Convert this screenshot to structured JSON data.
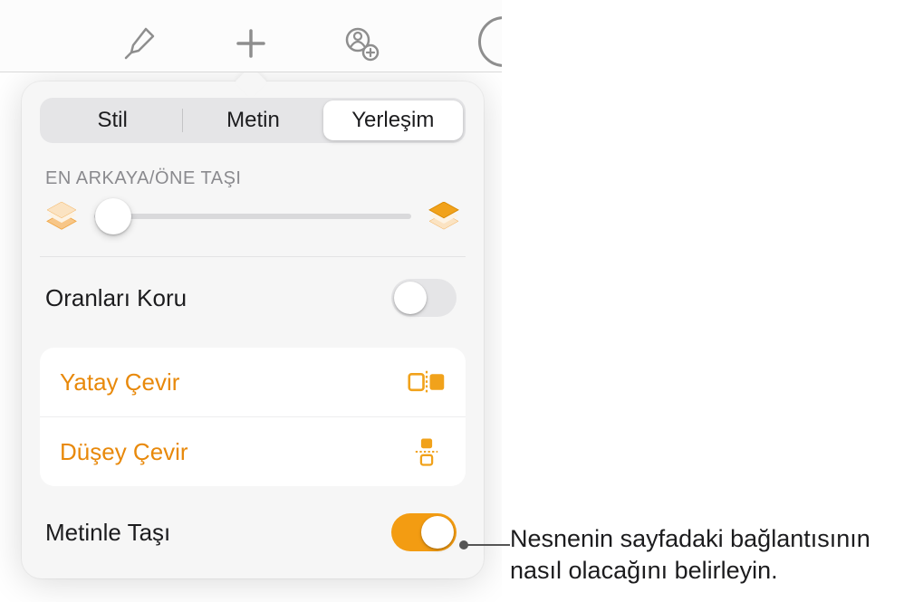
{
  "toolbar": {
    "icons": [
      "paintbrush-icon",
      "plus-icon",
      "collaborate-icon"
    ]
  },
  "tabs": {
    "style": "Stil",
    "text": "Metin",
    "arrange": "Yerleşim"
  },
  "arrange": {
    "section_label": "EN ARKAYA/ÖNE TAŞI",
    "constrain_label": "Oranları Koru",
    "constrain_on": false,
    "flip_h": "Yatay Çevir",
    "flip_v": "Düşey Çevir",
    "move_with_text_label": "Metinle Taşı",
    "move_with_text_on": true
  },
  "colors": {
    "accent": "#f39c12",
    "accent_text": "#e8890b"
  },
  "callout": {
    "text": "Nesnenin sayfadaki bağlantısının nasıl olacağını belirleyin."
  }
}
